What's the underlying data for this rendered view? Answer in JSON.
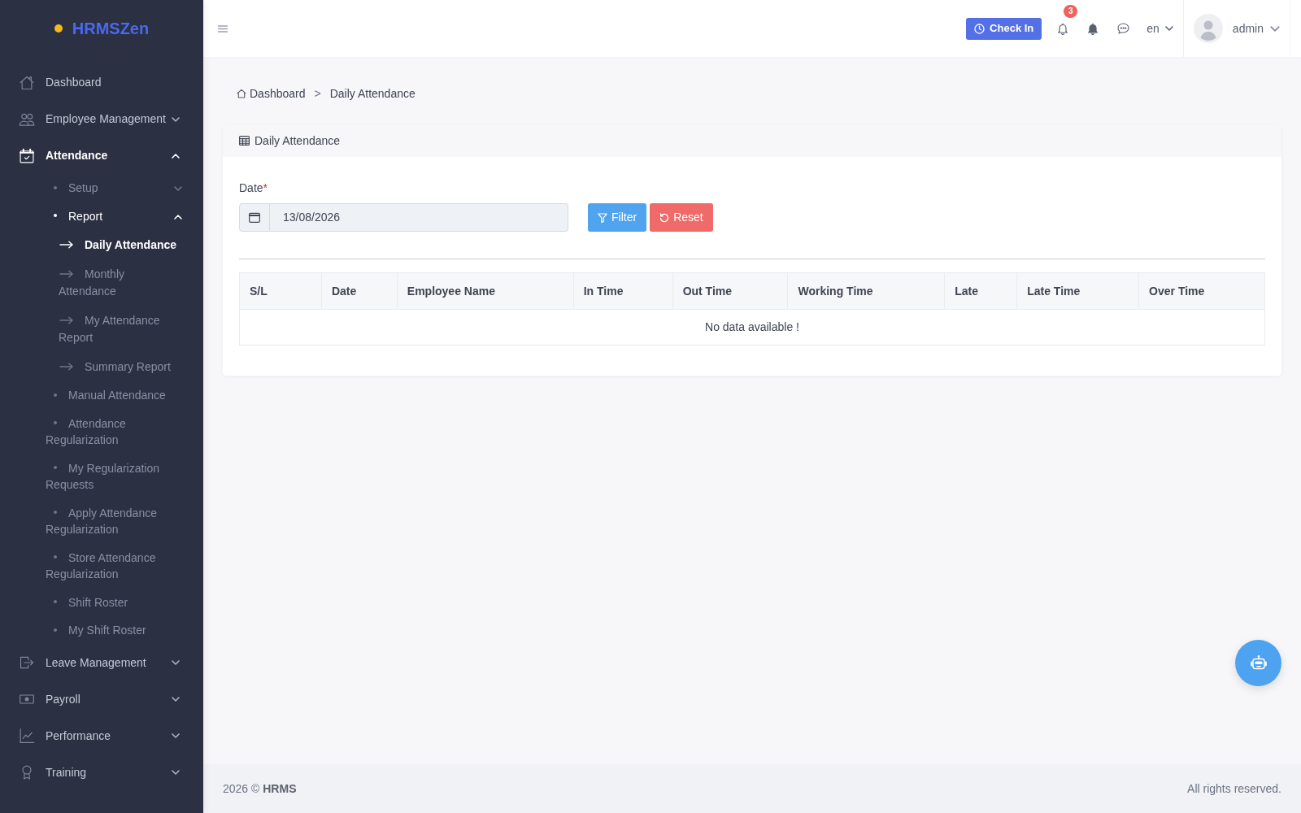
{
  "sidebar": {
    "logo": "HRMSZen",
    "items": [
      {
        "label": "Dashboard",
        "kind": "link",
        "selected": false
      },
      {
        "label": "Employee Management",
        "kind": "group",
        "selected": false,
        "expanded": false
      },
      {
        "label": "Attendance",
        "kind": "group",
        "selected": true,
        "expanded": true,
        "children": [
          {
            "label": "Setup",
            "kind": "group",
            "selected": false,
            "expanded": false
          },
          {
            "label": "Report",
            "kind": "group",
            "selected": true,
            "expanded": true,
            "children": [
              {
                "label": "Daily Attendance",
                "selected": true
              },
              {
                "label": "Monthly Attendance",
                "selected": false
              },
              {
                "label": "My Attendance Report",
                "selected": false
              },
              {
                "label": "Summary Report",
                "selected": false
              }
            ]
          },
          {
            "label": "Manual Attendance",
            "kind": "link",
            "selected": false
          },
          {
            "label": "Attendance Regularization",
            "kind": "link",
            "selected": false
          },
          {
            "label": "My Regularization Requests",
            "kind": "link",
            "selected": false
          },
          {
            "label": "Apply Attendance Regularization",
            "kind": "link",
            "selected": false
          },
          {
            "label": "Store Attendance Regularization",
            "kind": "link",
            "selected": false
          },
          {
            "label": "Shift Roster",
            "kind": "link",
            "selected": false
          },
          {
            "label": "My Shift Roster",
            "kind": "link",
            "selected": false
          }
        ]
      },
      {
        "label": "Leave Management",
        "kind": "group",
        "selected": false,
        "expanded": false
      },
      {
        "label": "Payroll",
        "kind": "group",
        "selected": false,
        "expanded": false
      },
      {
        "label": "Performance",
        "kind": "group",
        "selected": false,
        "expanded": false
      },
      {
        "label": "Training",
        "kind": "group",
        "selected": false,
        "expanded": false
      }
    ]
  },
  "topbar": {
    "check_in": "Check In",
    "notification_count": "3",
    "language": "en",
    "user": "admin"
  },
  "breadcrumb": {
    "items": [
      "Dashboard",
      "Daily Attendance"
    ],
    "separator": ">"
  },
  "card": {
    "title": "Daily Attendance",
    "date_field": {
      "label": "Date",
      "required_mark": "*",
      "value": "13/08/2026"
    },
    "buttons": [
      {
        "label": "Filter",
        "kind": "filter"
      },
      {
        "label": "Reset",
        "kind": "reset"
      }
    ],
    "table": {
      "columns": [
        "S/L",
        "Date",
        "Employee Name",
        "In Time",
        "Out Time",
        "Working Time",
        "Late",
        "Late Time",
        "Over Time"
      ],
      "empty_message": "No data available !"
    }
  },
  "footer": {
    "copyright": "2026 © **HRMS**",
    "rights": "All rights reserved."
  }
}
